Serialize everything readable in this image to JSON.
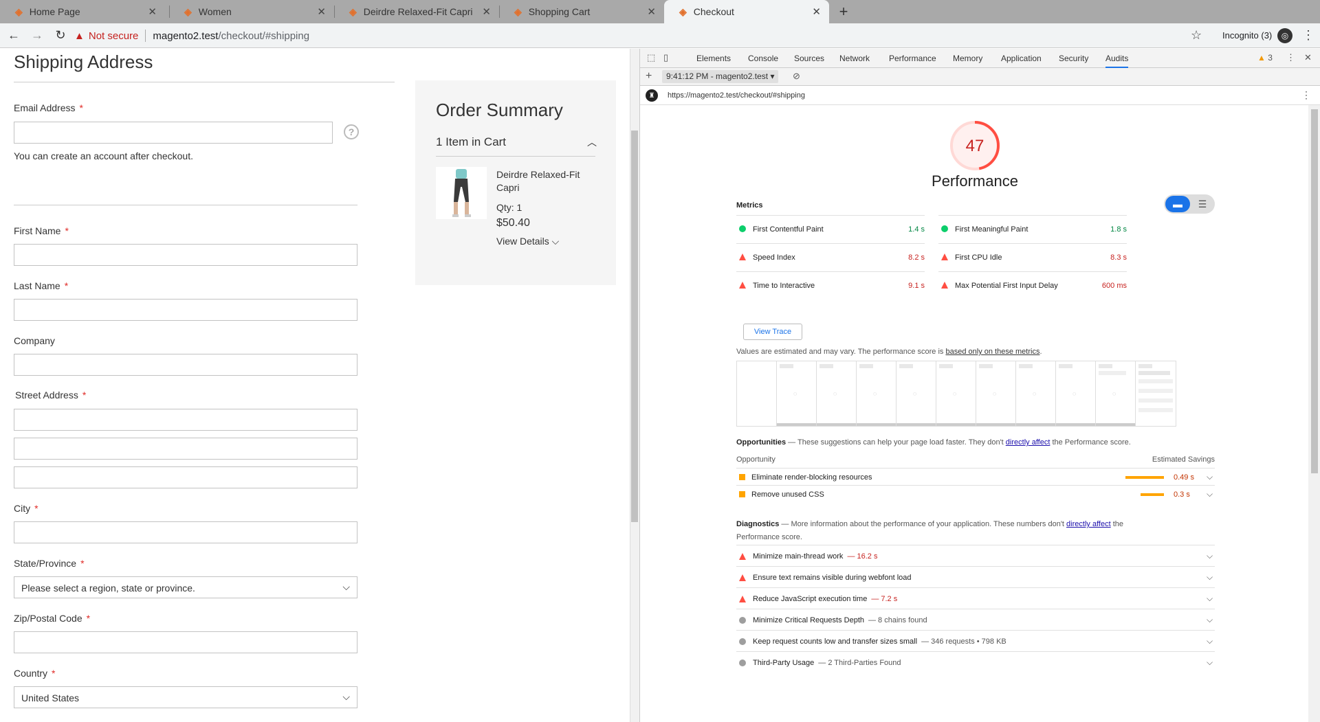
{
  "tabs": [
    {
      "title": "Home Page"
    },
    {
      "title": "Women"
    },
    {
      "title": "Deirdre Relaxed-Fit Capri"
    },
    {
      "title": "Shopping Cart"
    },
    {
      "title": "Checkout"
    }
  ],
  "new_tab_label": "+",
  "toolbar": {
    "not_secure": "Not secure",
    "url_host": "magento2.test",
    "url_path": "/checkout/#shipping",
    "incognito": "Incognito (3)"
  },
  "page": {
    "title": "Shipping Address",
    "email_label": "Email Address",
    "email_note": "You can create an account after checkout.",
    "first_name_label": "First Name",
    "last_name_label": "Last Name",
    "company_label": "Company",
    "street_label": "Street Address",
    "city_label": "City",
    "state_label": "State/Province",
    "state_value": "Please select a region, state or province.",
    "zip_label": "Zip/Postal Code",
    "country_label": "Country",
    "country_value": "United States",
    "required_mark": "*"
  },
  "order_summary": {
    "title": "Order Summary",
    "items_label": "1 Item in Cart",
    "product_name": "Deirdre Relaxed-Fit Capri",
    "qty": "Qty: 1",
    "price": "$50.40",
    "view_details": "View Details"
  },
  "devtools": {
    "tabs": [
      "Elements",
      "Console",
      "Sources",
      "Network",
      "Performance",
      "Memory",
      "Application",
      "Security",
      "Audits"
    ],
    "active_tab": "Audits",
    "warnings_count": "3",
    "session": "9:41:12 PM - magento2.test",
    "report_url": "https://magento2.test/checkout/#shipping",
    "score": 47,
    "category_title": "Performance",
    "metrics_heading": "Metrics",
    "metrics": [
      {
        "name": "First Contentful Paint",
        "value": "1.4 s",
        "status": "pass"
      },
      {
        "name": "First Meaningful Paint",
        "value": "1.8 s",
        "status": "pass"
      },
      {
        "name": "Speed Index",
        "value": "8.2 s",
        "status": "fail"
      },
      {
        "name": "First CPU Idle",
        "value": "8.3 s",
        "status": "fail"
      },
      {
        "name": "Time to Interactive",
        "value": "9.1 s",
        "status": "fail"
      },
      {
        "name": "Max Potential First Input Delay",
        "value": "600 ms",
        "status": "fail"
      }
    ],
    "view_trace": "View Trace",
    "estimate_note": "Values are estimated and may vary. The performance score is ",
    "estimate_link": "based only on these metrics",
    "estimate_end": ".",
    "opportunities_heading": "Opportunities",
    "opportunities_desc_a": " — These suggestions can help your page load faster. They don't ",
    "opportunities_link": "directly affect",
    "opportunities_desc_b": " the Performance score.",
    "opportunity_col": "Opportunity",
    "savings_col": "Estimated Savings",
    "opportunities": [
      {
        "name": "Eliminate render-blocking resources",
        "value": "0.49 s",
        "fraction": 1.0
      },
      {
        "name": "Remove unused CSS",
        "value": "0.3 s",
        "fraction": 0.61
      }
    ],
    "diagnostics_heading": "Diagnostics",
    "diagnostics_desc_a": " — More information about the performance of your application. These numbers don't ",
    "diagnostics_link": "directly affect",
    "diagnostics_desc_b": " the",
    "diagnostics_desc_c": "Performance score.",
    "diagnostics": [
      {
        "name": "Minimize main-thread work",
        "detail": "— 16.2 s",
        "status": "fail"
      },
      {
        "name": "Ensure text remains visible during webfont load",
        "detail": "",
        "status": "fail"
      },
      {
        "name": "Reduce JavaScript execution time",
        "detail": "— 7.2 s",
        "status": "fail"
      },
      {
        "name": "Minimize Critical Requests Depth",
        "detail": "— 8 chains found",
        "status": "info"
      },
      {
        "name": "Keep request counts low and transfer sizes small",
        "detail": "— 346 requests • 798 KB",
        "status": "info"
      },
      {
        "name": "Third-Party Usage",
        "detail": "— 2 Third-Parties Found",
        "status": "info"
      }
    ]
  },
  "colors": {
    "score_fail": "#ff4e42",
    "pass": "#0cce6b",
    "average": "#ffa400",
    "accent": "#1a73e8"
  }
}
